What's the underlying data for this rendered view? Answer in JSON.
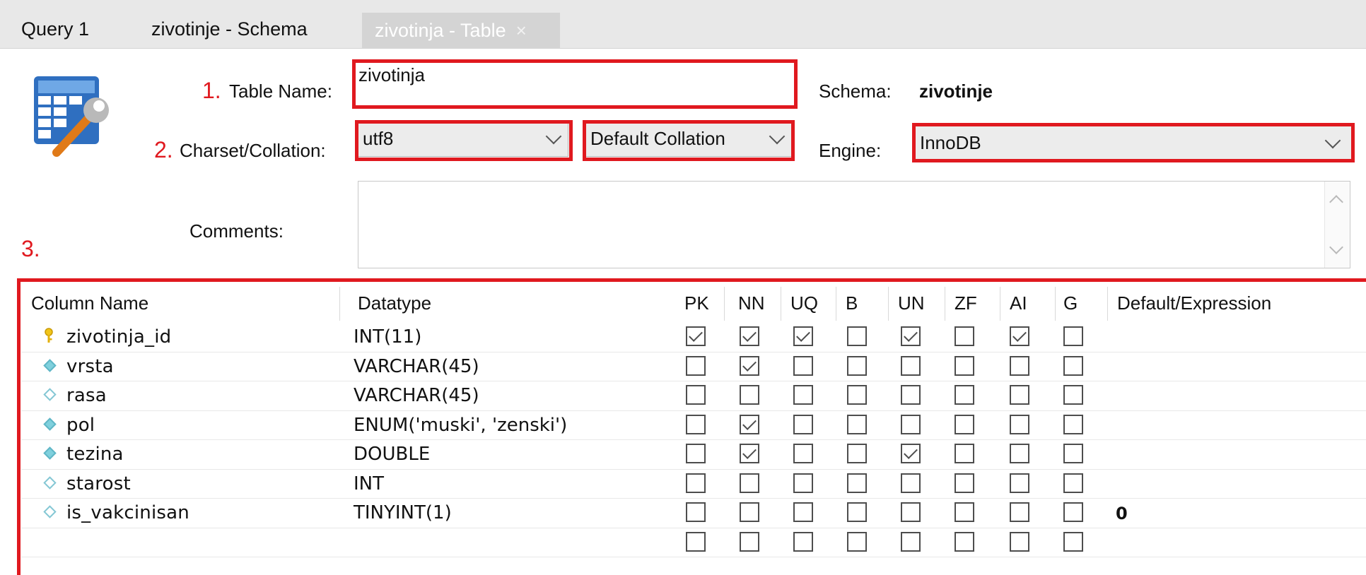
{
  "tabs": [
    {
      "label": "Query 1"
    },
    {
      "label": "zivotinje - Schema"
    },
    {
      "label": "zivotinja - Table",
      "close": "×"
    }
  ],
  "annotations": {
    "n1": "1.",
    "n2": "2.",
    "n3": "3."
  },
  "form": {
    "table_name_label": "Table Name:",
    "table_name_value": "zivotinja",
    "schema_label": "Schema:",
    "schema_value": "zivotinje",
    "charset_label": "Charset/Collation:",
    "charset_value": "utf8",
    "collation_value": "Default Collation",
    "engine_label": "Engine:",
    "engine_value": "InnoDB",
    "comments_label": "Comments:",
    "comments_value": ""
  },
  "grid": {
    "headers": [
      "Column Name",
      "Datatype",
      "PK",
      "NN",
      "UQ",
      "B",
      "UN",
      "ZF",
      "AI",
      "G",
      "Default/Expression"
    ],
    "rows": [
      {
        "name": "zivotinja_id",
        "type": "INT(11)",
        "icon": "key",
        "flags": [
          1,
          1,
          1,
          0,
          1,
          0,
          1,
          0
        ],
        "default": ""
      },
      {
        "name": "vrsta",
        "type": "VARCHAR(45)",
        "icon": "filled",
        "flags": [
          0,
          1,
          0,
          0,
          0,
          0,
          0,
          0
        ],
        "default": ""
      },
      {
        "name": "rasa",
        "type": "VARCHAR(45)",
        "icon": "hollow",
        "flags": [
          0,
          0,
          0,
          0,
          0,
          0,
          0,
          0
        ],
        "default": ""
      },
      {
        "name": "pol",
        "type": "ENUM('muski', 'zenski')",
        "icon": "filled",
        "flags": [
          0,
          1,
          0,
          0,
          0,
          0,
          0,
          0
        ],
        "default": ""
      },
      {
        "name": "tezina",
        "type": "DOUBLE",
        "icon": "filled",
        "flags": [
          0,
          1,
          0,
          0,
          1,
          0,
          0,
          0
        ],
        "default": ""
      },
      {
        "name": "starost",
        "type": "INT",
        "icon": "hollow",
        "flags": [
          0,
          0,
          0,
          0,
          0,
          0,
          0,
          0
        ],
        "default": ""
      },
      {
        "name": "is_vakcinisan",
        "type": "TINYINT(1)",
        "icon": "hollow",
        "flags": [
          0,
          0,
          0,
          0,
          0,
          0,
          0,
          0
        ],
        "default": "0"
      },
      {
        "name": "",
        "type": "",
        "icon": "none",
        "flags": [
          0,
          0,
          0,
          0,
          0,
          0,
          0,
          0
        ],
        "default": ""
      }
    ]
  },
  "colors": {
    "annotation_red": "#e0191f",
    "active_tab": "#d4d4d4",
    "diamond": "#7fd0dd"
  }
}
